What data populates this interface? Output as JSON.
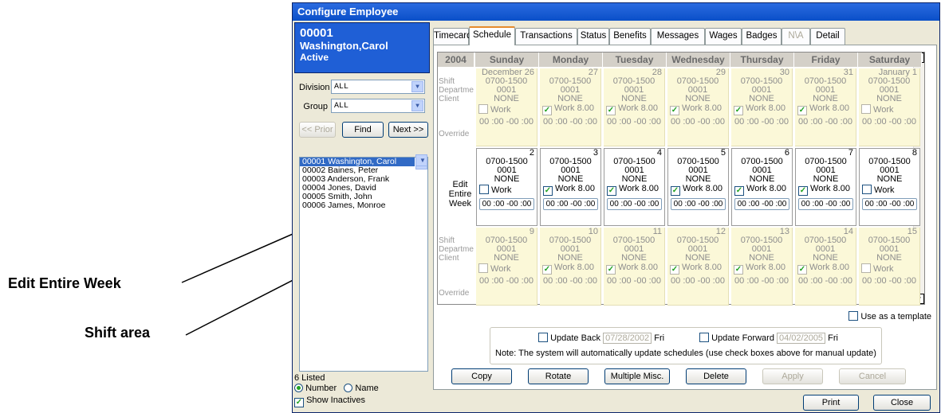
{
  "callouts": {
    "edit_week": "Edit Entire Week",
    "shift_area": "Shift area"
  },
  "window": {
    "title": "Configure Employee"
  },
  "employee": {
    "id": "00001",
    "name": "Washington,Carol",
    "status": "Active"
  },
  "filters": {
    "division_label": "Division",
    "division_value": "ALL",
    "group_label": "Group",
    "group_value": "ALL"
  },
  "nav": {
    "prior": "<< Prior",
    "find": "Find",
    "next": "Next >>"
  },
  "employees": [
    "00001  Washington, Carol",
    "00002  Baines, Peter",
    "00003  Anderson, Frank",
    "00004  Jones, David",
    "00005  Smith, John",
    "00006  James, Monroe"
  ],
  "listed": "6 Listed",
  "sort": {
    "number": "Number",
    "name": "Name"
  },
  "show_inactives": "Show Inactives",
  "tabs": [
    "Timecard",
    "Schedule",
    "Transactions",
    "Status",
    "Benefits",
    "Messages",
    "Wages",
    "Badges",
    "N\\A",
    "Detail"
  ],
  "schedule": {
    "year": "2004",
    "days": [
      "Sunday",
      "Monday",
      "Tuesday",
      "Wednesday",
      "Thursday",
      "Friday",
      "Saturday"
    ],
    "row_labels": [
      "Shift",
      "Departme",
      "Client",
      "",
      "Override"
    ],
    "edit_week": "Edit Entire Week",
    "weeks": [
      {
        "dates": [
          "December 26",
          "27",
          "28",
          "29",
          "30",
          "31",
          "January 1"
        ],
        "work": [
          false,
          true,
          true,
          true,
          true,
          true,
          false
        ]
      },
      {
        "dates": [
          "2",
          "3",
          "4",
          "5",
          "6",
          "7",
          "8"
        ],
        "work": [
          false,
          true,
          true,
          true,
          true,
          true,
          false
        ]
      },
      {
        "dates": [
          "9",
          "10",
          "11",
          "12",
          "13",
          "14",
          "15"
        ],
        "work": [
          false,
          true,
          true,
          true,
          true,
          true,
          false
        ]
      }
    ],
    "shift": "0700-1500",
    "dept": "0001",
    "client": "NONE",
    "work_label": "Work",
    "work_hours": "8.00",
    "override": "00 :00 -00 :00"
  },
  "template_label": "Use as a template",
  "update": {
    "back_label": "Update Back",
    "back_date": "07/28/2002",
    "back_day": "Fri",
    "fwd_label": "Update Forward",
    "fwd_date": "04/02/2005",
    "fwd_day": "Fri",
    "note": "Note: The system will automatically update schedules (use check boxes above for manual update)"
  },
  "actions": [
    "Copy",
    "Rotate",
    "Multiple Misc.",
    "Delete",
    "Apply",
    "Cancel"
  ],
  "footer": {
    "print": "Print",
    "close": "Close"
  }
}
